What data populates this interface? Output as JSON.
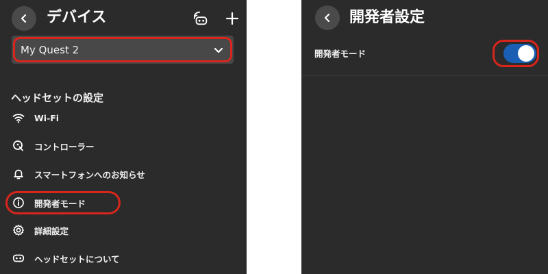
{
  "left": {
    "title": "デバイス",
    "device_select": {
      "value": "My Quest 2"
    },
    "section_title": "ヘッドセットの設定",
    "menu": [
      {
        "label": "Wi-Fi",
        "icon": "wifi-icon"
      },
      {
        "label": "コントローラー",
        "icon": "controller-icon"
      },
      {
        "label": "スマートフォンへのお知らせ",
        "icon": "bell-icon"
      },
      {
        "label": "開発者モード",
        "icon": "info-icon"
      },
      {
        "label": "詳細設定",
        "icon": "gear-icon"
      },
      {
        "label": "ヘッドセットについて",
        "icon": "headset-icon"
      }
    ],
    "header_icons": [
      "cast-headset-icon",
      "plus-icon"
    ]
  },
  "right": {
    "title": "開発者設定",
    "setting": {
      "label": "開発者モード",
      "enabled": true
    }
  },
  "colors": {
    "panel_bg": "#2b2b2b",
    "highlight": "#d9261c",
    "toggle_on": "#1a5fb4",
    "select_bg": "#484848"
  }
}
